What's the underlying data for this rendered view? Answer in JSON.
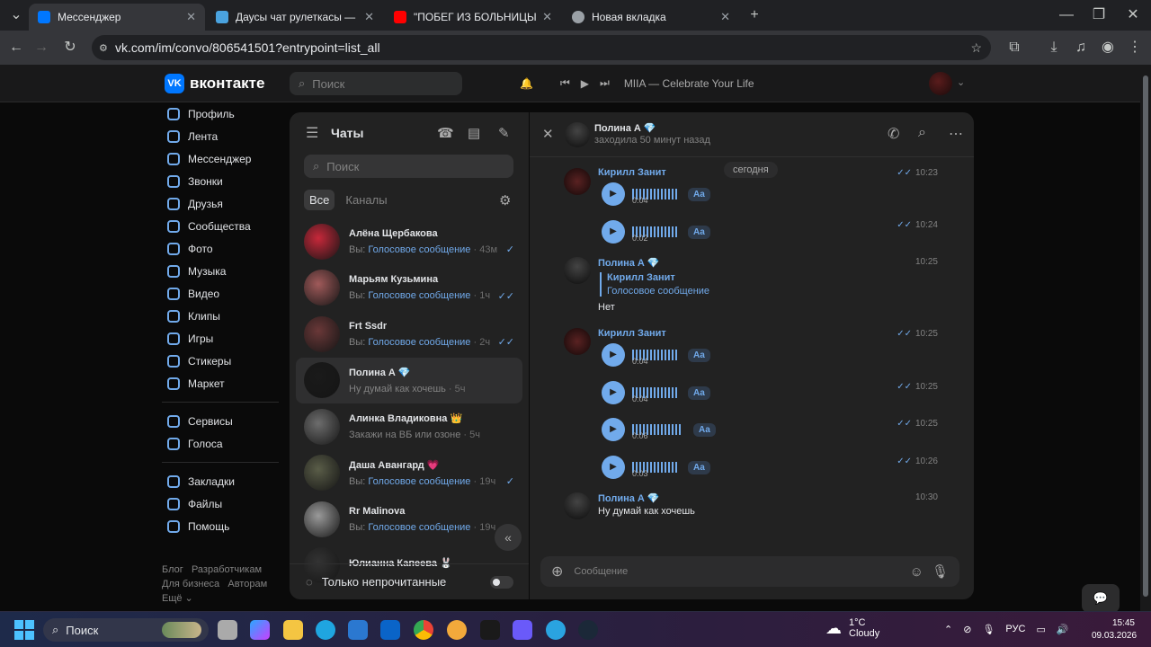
{
  "browser": {
    "tabs": [
      {
        "title": "Мессенджер",
        "color": "#0077ff"
      },
      {
        "title": "Даусы чат рулеткасы — Nekto",
        "color": "#4aa3df"
      },
      {
        "title": "\"ПОБЕГ ИЗ БОЛЬНИЦЫ\" (части",
        "color": "#ff0000"
      },
      {
        "title": "Новая вкладка",
        "color": "#9aa0a6"
      }
    ],
    "url": "vk.com/im/convo/806541501?entrypoint=list_all"
  },
  "header": {
    "logo": "вконтакте",
    "logo_mark": "VK",
    "search_placeholder": "Поиск",
    "now_playing": "MIIA — Celebrate Your Life"
  },
  "nav": {
    "items": [
      "Профиль",
      "Лента",
      "Мессенджер",
      "Звонки",
      "Друзья",
      "Сообщества",
      "Фото",
      "Музыка",
      "Видео",
      "Клипы",
      "Игры",
      "Стикеры",
      "Маркет"
    ],
    "items2": [
      "Сервисы",
      "Голоса"
    ],
    "items3": [
      "Закладки",
      "Файлы",
      "Помощь"
    ],
    "footer": [
      "Блог",
      "Разработчикам",
      "Для бизнеса",
      "Авторам",
      "Ещё ⌄"
    ]
  },
  "chats": {
    "title": "Чаты",
    "search_placeholder": "Поиск",
    "filter_all": "Все",
    "filter_channels": "Каналы",
    "unread_only": "Только непрочитанные",
    "list": [
      {
        "name": "Алёна Щербакова",
        "link": "Голосовое сообщение",
        "time": "43м",
        "read": "✓",
        "prefix": "Вы: ",
        "avatar": "#c7283a"
      },
      {
        "name": "Марьям Кузьмина",
        "link": "Голосовое сообщение",
        "time": "1ч",
        "read": "✓✓",
        "prefix": "Вы: ",
        "avatar": "#a05a5a"
      },
      {
        "name": "Frt Ssdr",
        "link": "Голосовое сообщение",
        "time": "2ч",
        "read": "✓✓",
        "prefix": "Вы: ",
        "avatar": "#6a3838"
      },
      {
        "name": "Полина А 💎",
        "text": "Ну думай как хочешь",
        "time": "5ч",
        "read": "",
        "prefix": "",
        "avatar": "#1a1a1a"
      },
      {
        "name": "Алинка Владиковна 👑",
        "text": "Закажи на ВБ или озоне",
        "time": "5ч",
        "read": "",
        "prefix": "",
        "avatar": "#6d6d6d"
      },
      {
        "name": "Даша Авангард 💗",
        "link": "Голосовое сообщение",
        "time": "19ч",
        "read": "✓",
        "prefix": "Вы: ",
        "avatar": "#5a5d48"
      },
      {
        "name": "Rr Malinova",
        "link": "Голосовое сообщение",
        "time": "19ч",
        "read": "",
        "prefix": "Вы: ",
        "avatar": "#9a9a9a"
      },
      {
        "name": "Юлианна Капеева 🐰",
        "text": "",
        "time": "",
        "read": "",
        "prefix": "",
        "avatar": "#333333"
      }
    ]
  },
  "convo": {
    "peer_name": "Полина А 💎",
    "peer_status": "заходила 50 минут назад",
    "date_divider": "сегодня",
    "composer_placeholder": "Сообщение",
    "sender1": "Кирилл Занит",
    "sender2": "Полина А 💎",
    "aa": "Aa",
    "voice1": {
      "dur": "0:04",
      "time": "10:23"
    },
    "voice2": {
      "dur": "0:02",
      "time": "10:24"
    },
    "reply_msg": {
      "time": "10:25",
      "reply_name": "Кирилл Занит",
      "reply_text": "Голосовое сообщение",
      "text": "Нет"
    },
    "voice3": {
      "dur": "0:04",
      "time": "10:25"
    },
    "voice4": {
      "dur": "0:04",
      "time": "10:25"
    },
    "voice5": {
      "dur": "0:06",
      "time": "10:25"
    },
    "voice6": {
      "dur": "0:03",
      "time": "10:26"
    },
    "last_msg": {
      "time": "10:30",
      "text": "Ну думай как хочешь"
    }
  },
  "taskbar": {
    "search": "Поиск",
    "weather_temp": "1°C",
    "weather_desc": "Cloudy",
    "lang": "РУС",
    "time": "15:45",
    "date": "09.03.2026"
  }
}
